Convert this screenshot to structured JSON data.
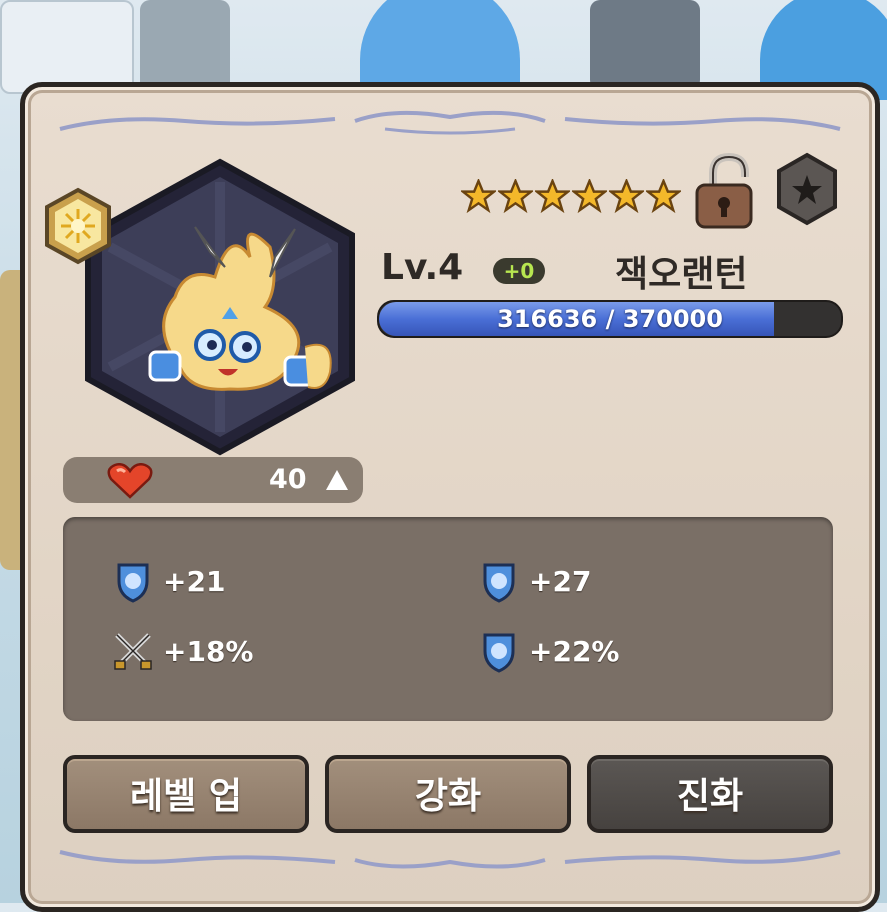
{
  "character": {
    "name": "잭오랜턴",
    "level_label": "Lv.4",
    "enhance_badge": "+0",
    "stars": 6,
    "exp": {
      "text": "316636 / 370000",
      "current": 316636,
      "max": 370000
    }
  },
  "affection": {
    "value": "40"
  },
  "stats": [
    {
      "icon": "shield-stat-icon",
      "value": "+21"
    },
    {
      "icon": "shield-stat-icon",
      "value": "+27"
    },
    {
      "icon": "crossed-swords-icon",
      "value": "+18%"
    },
    {
      "icon": "shield-stat-icon",
      "value": "+22%"
    }
  ],
  "buttons": {
    "level_up": "레벨 업",
    "enhance": "강화",
    "evolve": "진화"
  },
  "colors": {
    "panel": "#e2d5c6",
    "exp_fill": "#4a6fd6",
    "plus_text": "#b7e650",
    "button_brown": "#8c7866",
    "button_dark": "#46423f"
  }
}
